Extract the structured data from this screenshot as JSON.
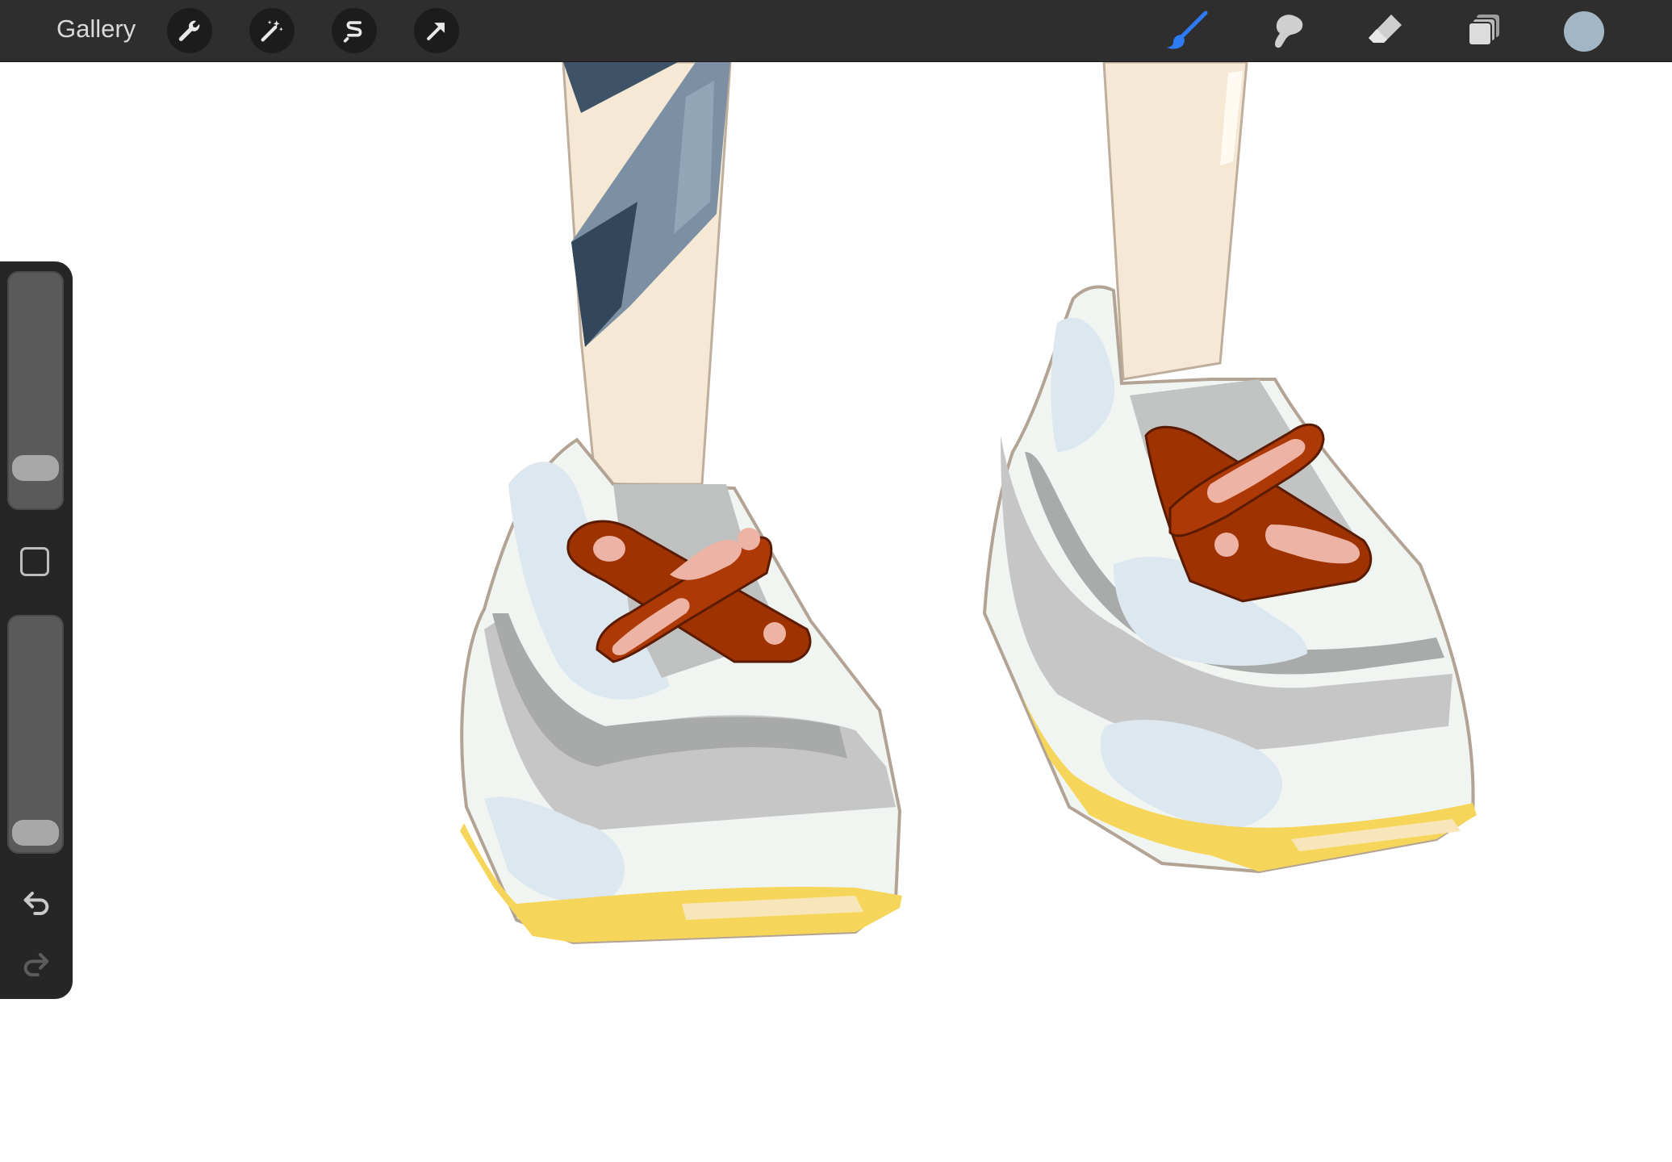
{
  "toolbar": {
    "gallery_label": "Gallery",
    "left_tools": [
      "wrench-icon",
      "magic-wand-icon",
      "selection-icon",
      "transform-arrow-icon"
    ],
    "right_tools": [
      "brush-icon",
      "smudge-icon",
      "eraser-icon",
      "layers-icon"
    ],
    "active_tool": "brush",
    "active_tool_color": "#2f7bf5",
    "current_color": "#a3b6c5"
  },
  "sidebar": {
    "brush_size": 0.12,
    "opacity": 0.05,
    "controls": [
      "brush-size-slider",
      "modifier-button",
      "opacity-slider",
      "undo-icon",
      "redo-icon"
    ]
  },
  "canvas": {
    "subject": "illustration",
    "background": "#ffffff"
  }
}
